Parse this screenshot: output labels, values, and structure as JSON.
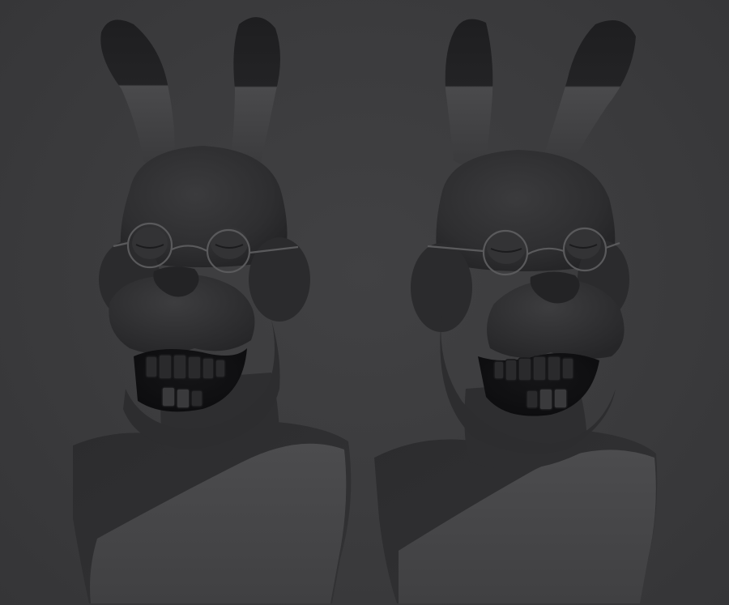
{
  "scene": {
    "background_color": "#3c3c3e",
    "clay_color": "#2f2f31",
    "clay_highlight": "#4a4a4c",
    "models": [
      {
        "name": "rabbit-bust-left",
        "pose": "front-three-quarter"
      },
      {
        "name": "rabbit-bust-right",
        "pose": "front-three-quarter-mirrored"
      }
    ]
  }
}
